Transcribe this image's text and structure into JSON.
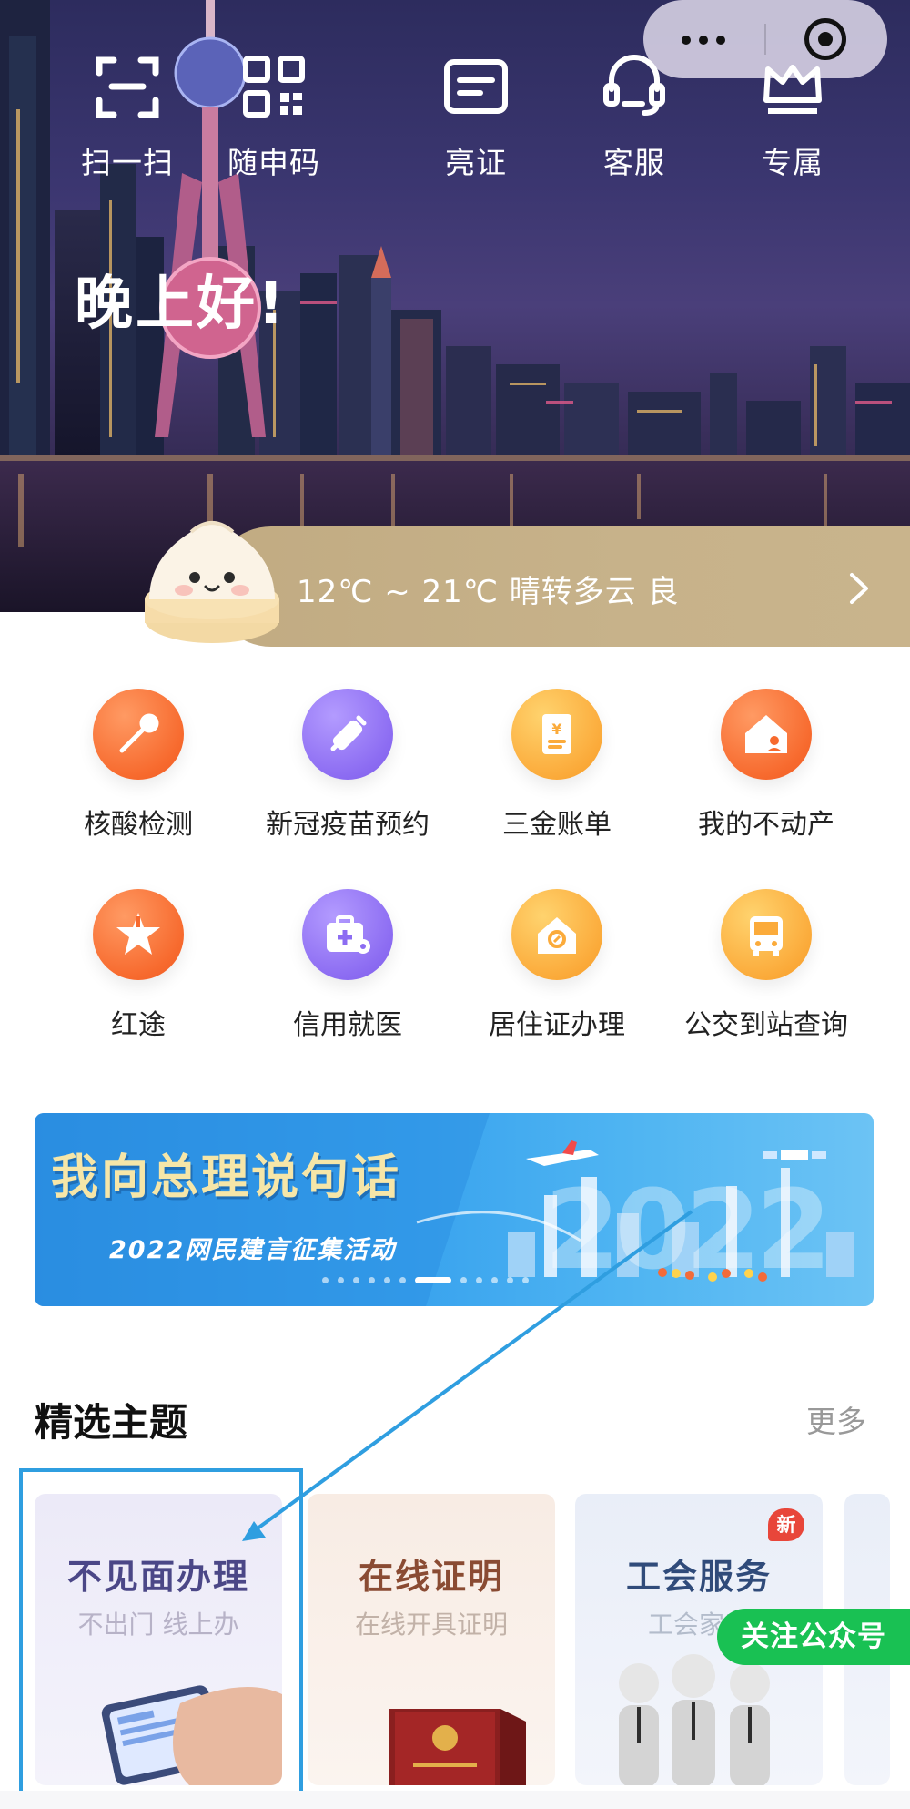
{
  "toolbar": {
    "items": [
      {
        "label": "扫一扫",
        "icon": "scan-icon"
      },
      {
        "label": "随申码",
        "icon": "qr-code-icon"
      },
      {
        "label": "亮证",
        "icon": "id-card-icon"
      },
      {
        "label": "客服",
        "icon": "headset-icon"
      },
      {
        "label": "专属",
        "icon": "crown-icon"
      }
    ]
  },
  "capsule": {
    "more_icon": "more-dots-icon",
    "close_icon": "target-icon"
  },
  "greeting": "晚上好!",
  "weather": {
    "text": "12℃ ~ 21℃ 晴转多云 良",
    "mascot_icon": "bun-mascot-icon"
  },
  "services": [
    {
      "label": "核酸检测",
      "icon": "swab-icon",
      "color": "#f76a2e"
    },
    {
      "label": "新冠疫苗预约",
      "icon": "syringe-icon",
      "color": "#8c6cf2"
    },
    {
      "label": "三金账单",
      "icon": "bill-icon",
      "color": "#fbab3b"
    },
    {
      "label": "我的不动产",
      "icon": "house-icon",
      "color": "#f76a2e"
    },
    {
      "label": "红途",
      "icon": "star-icon",
      "color": "#f76a2e"
    },
    {
      "label": "信用就医",
      "icon": "medical-kit-icon",
      "color": "#8c6cf2"
    },
    {
      "label": "居住证办理",
      "icon": "home-badge-icon",
      "color": "#fbab3b"
    },
    {
      "label": "公交到站查询",
      "icon": "bus-icon",
      "color": "#fbab3b"
    }
  ],
  "banner": {
    "title": "我向总理说句话",
    "subtitle": "2022网民建言征集活动",
    "year_art": "2022",
    "slides": 12,
    "active_slide": 6
  },
  "featured": {
    "title": "精选主题",
    "more": "更多",
    "cards": [
      {
        "title": "不见面办理",
        "subtitle": "不出门 线上办"
      },
      {
        "title": "在线证明",
        "subtitle": "在线开具证明"
      },
      {
        "title": "工会服务",
        "subtitle": "工会家庭",
        "badge": "新"
      }
    ],
    "follow_button": "关注公众号"
  },
  "colors": {
    "highlight": "#2f9ee0",
    "follow": "#19c153",
    "badge": "#e8463a",
    "weather_bar": "#c7b28a"
  }
}
